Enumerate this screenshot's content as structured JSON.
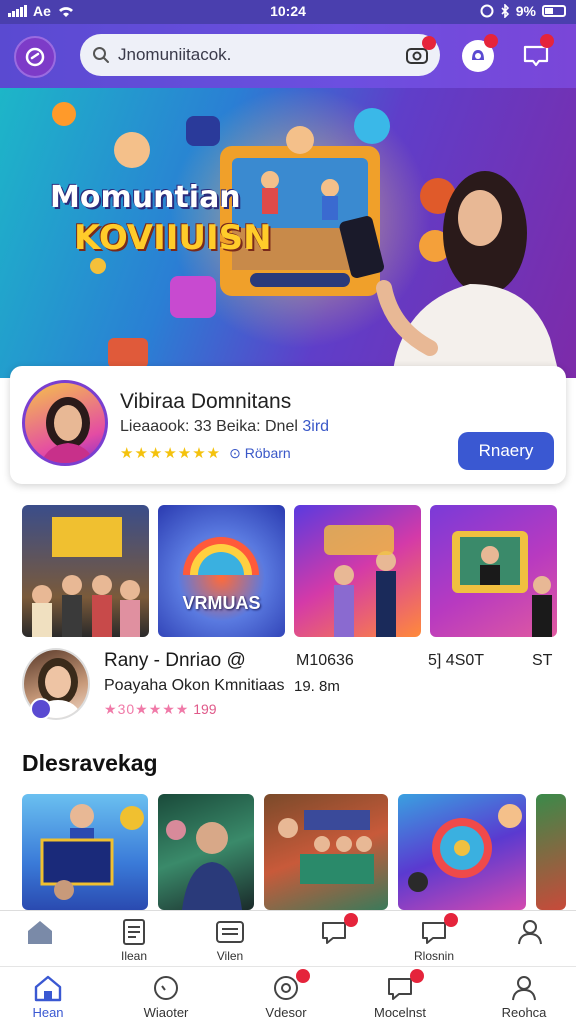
{
  "status_bar": {
    "carrier": "Ae",
    "time": "10:24",
    "battery": "9%"
  },
  "header": {
    "search_text": "Jnomuniitacok."
  },
  "hero": {
    "title_line1": "Momuntian",
    "title_line2": "KOVIIUISN"
  },
  "profile_card": {
    "name": "Vibiraa Domnitans",
    "subtitle_prefix": "Lieaaook: 33 Beika: Dnel",
    "subtitle_accent": "3ird",
    "rating_label": "Röbarn",
    "star_rating": 5,
    "button_label": "Rnaery"
  },
  "thumbnails": [
    {
      "label": ""
    },
    {
      "label": "VRMUAS"
    },
    {
      "label": ""
    },
    {
      "label": ""
    }
  ],
  "creator": {
    "name": "Rany - Dnriao @",
    "subtitle": "Poayaha Okon Kmnitiaas",
    "rating_text": "30",
    "star_rating": 4,
    "count": "199",
    "stats": [
      "M10636",
      "5] 4S0T",
      "ST"
    ],
    "sub_stat": "19. 8m"
  },
  "discover": {
    "title": "Dlesravekag"
  },
  "nav_top": [
    {
      "label": "",
      "icon": "home-icon"
    },
    {
      "label": "Ilean",
      "icon": "document-icon"
    },
    {
      "label": "Vilen",
      "icon": "video-card-icon"
    },
    {
      "label": "",
      "icon": "chat-icon"
    },
    {
      "label": "Rlosnin",
      "icon": "message-icon"
    },
    {
      "label": "",
      "icon": "profile-icon"
    }
  ],
  "nav_bottom": [
    {
      "label": "Hean",
      "icon": "home-icon",
      "active": true
    },
    {
      "label": "Wiaoter",
      "icon": "face-icon"
    },
    {
      "label": "Vdesor",
      "icon": "video-icon"
    },
    {
      "label": "Mocelnst",
      "icon": "messages-icon"
    },
    {
      "label": "Reohca",
      "icon": "profile-icon"
    }
  ],
  "colors": {
    "accent": "#3a58d2",
    "header": "#5a4ad1",
    "badge": "#e5243b",
    "star": "#f4c20d"
  }
}
